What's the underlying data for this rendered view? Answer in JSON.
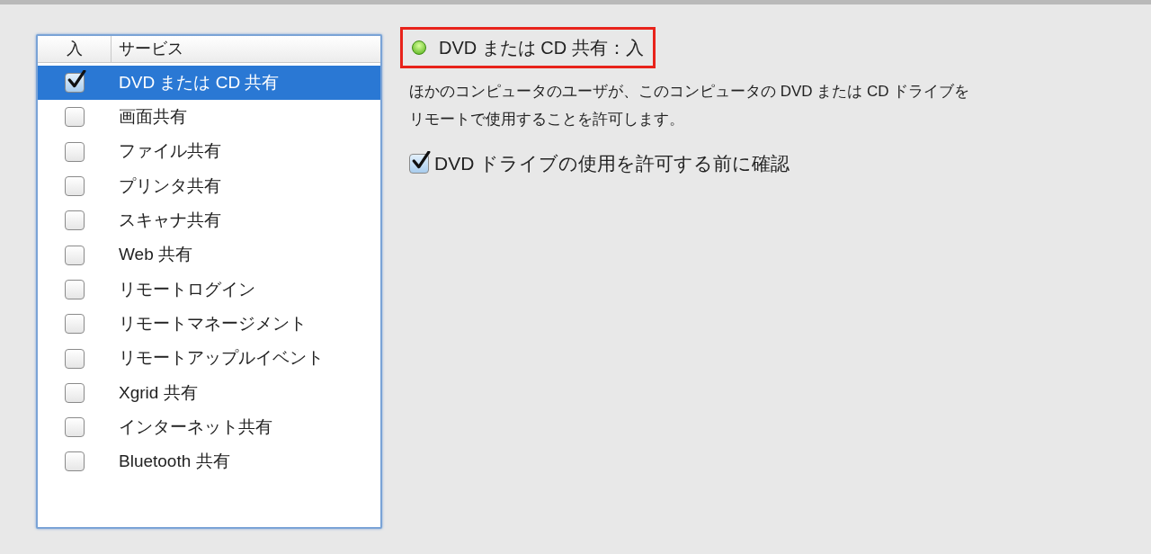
{
  "services_table": {
    "columns": [
      "入",
      "サービス"
    ],
    "rows": [
      {
        "name": "DVD または CD 共有",
        "checked": true,
        "selected": true
      },
      {
        "name": "画面共有",
        "checked": false,
        "selected": false
      },
      {
        "name": "ファイル共有",
        "checked": false,
        "selected": false
      },
      {
        "name": "プリンタ共有",
        "checked": false,
        "selected": false
      },
      {
        "name": "スキャナ共有",
        "checked": false,
        "selected": false
      },
      {
        "name": "Web 共有",
        "checked": false,
        "selected": false
      },
      {
        "name": "リモートログイン",
        "checked": false,
        "selected": false
      },
      {
        "name": "リモートマネージメント",
        "checked": false,
        "selected": false
      },
      {
        "name": "リモートアップルイベント",
        "checked": false,
        "selected": false
      },
      {
        "name": "Xgrid 共有",
        "checked": false,
        "selected": false
      },
      {
        "name": "インターネット共有",
        "checked": false,
        "selected": false
      },
      {
        "name": "Bluetooth 共有",
        "checked": false,
        "selected": false
      }
    ]
  },
  "status": {
    "label": "DVD または CD 共有：入",
    "on": true,
    "highlighted": true
  },
  "description_lines": [
    "ほかのコンピュータのユーザが、このコンピュータの DVD または CD ドライブを",
    "リモートで使用することを許可します。"
  ],
  "option": {
    "label": "DVD ドライブの使用を許可する前に確認",
    "checked": true
  }
}
